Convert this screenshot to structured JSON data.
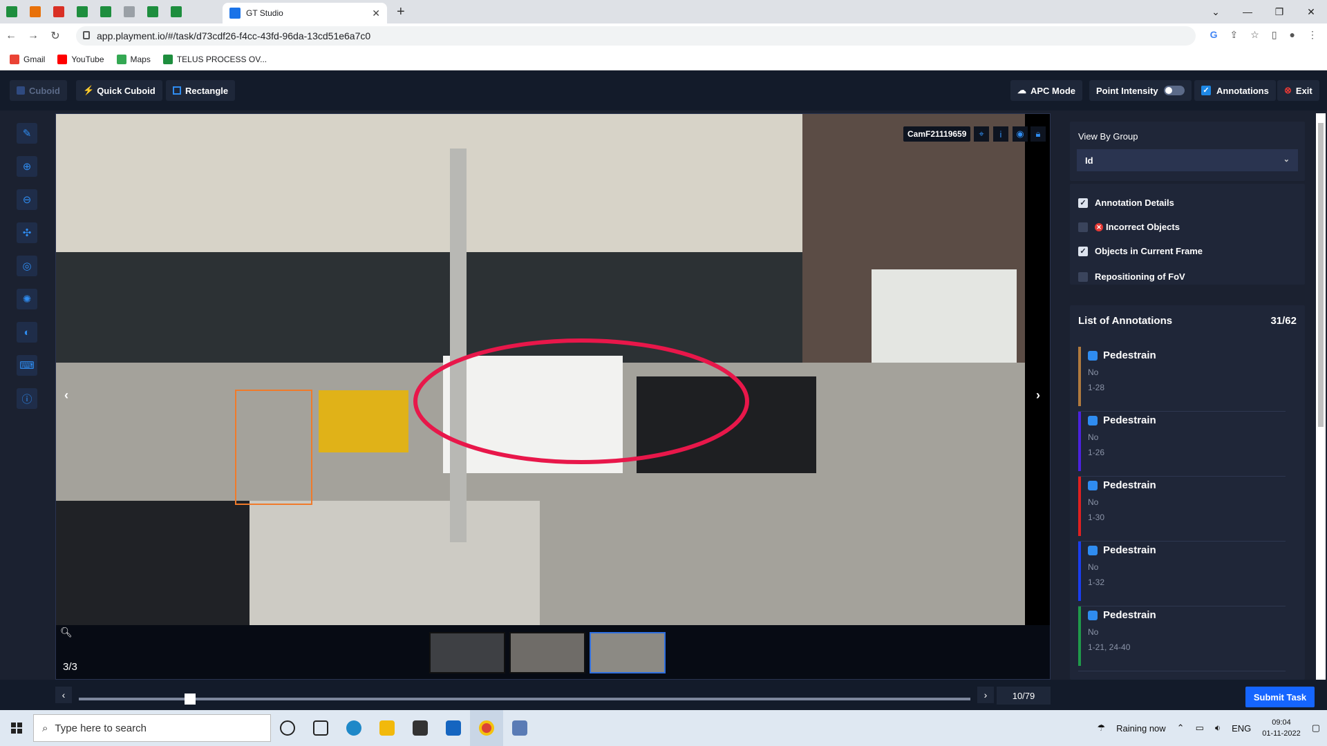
{
  "browser": {
    "active_tab_title": "GT Studio",
    "url": "app.playment.io/#/task/d73cdf26-f4cc-43fd-96da-13cd51e6a7c0",
    "bookmarks": [
      "Gmail",
      "YouTube",
      "Maps",
      "TELUS PROCESS OV..."
    ]
  },
  "toolbar": {
    "cuboid": "Cuboid",
    "quick_cuboid": "Quick Cuboid",
    "rectangle": "Rectangle",
    "apc_mode": "APC Mode",
    "point_intensity": "Point Intensity",
    "annotations": "Annotations",
    "exit": "Exit"
  },
  "canvas": {
    "camera_label": "CamF21119659",
    "frame_counter": "3/3"
  },
  "right_panel": {
    "view_by_group_label": "View By Group",
    "group_value": "Id",
    "checks": [
      {
        "label": "Annotation Details",
        "checked": true
      },
      {
        "label": "Incorrect Objects",
        "checked": false
      },
      {
        "label": "Objects in Current Frame",
        "checked": true
      },
      {
        "label": "Repositioning of FoV",
        "checked": false
      }
    ],
    "list_title": "List of Annotations",
    "list_count": "31/62",
    "annotations": [
      {
        "name": "Pedestrain",
        "status": "No",
        "range": "1-28",
        "color": "#b07a3e"
      },
      {
        "name": "Pedestrain",
        "status": "No",
        "range": "1-26",
        "color": "#4b22e0"
      },
      {
        "name": "Pedestrain",
        "status": "No",
        "range": "1-30",
        "color": "#e02020"
      },
      {
        "name": "Pedestrain",
        "status": "No",
        "range": "1-32",
        "color": "#1a3ef0"
      },
      {
        "name": "Pedestrain",
        "status": "No",
        "range": "1-21, 24-40",
        "color": "#1f9a4a"
      }
    ]
  },
  "bottom": {
    "frame_position": "10/79",
    "slider_fraction": 0.125,
    "submit": "Submit Task"
  },
  "taskbar": {
    "search_placeholder": "Type here to search",
    "weather": "Raining now",
    "lang": "ENG",
    "time": "09:04",
    "date": "01-11-2022"
  }
}
